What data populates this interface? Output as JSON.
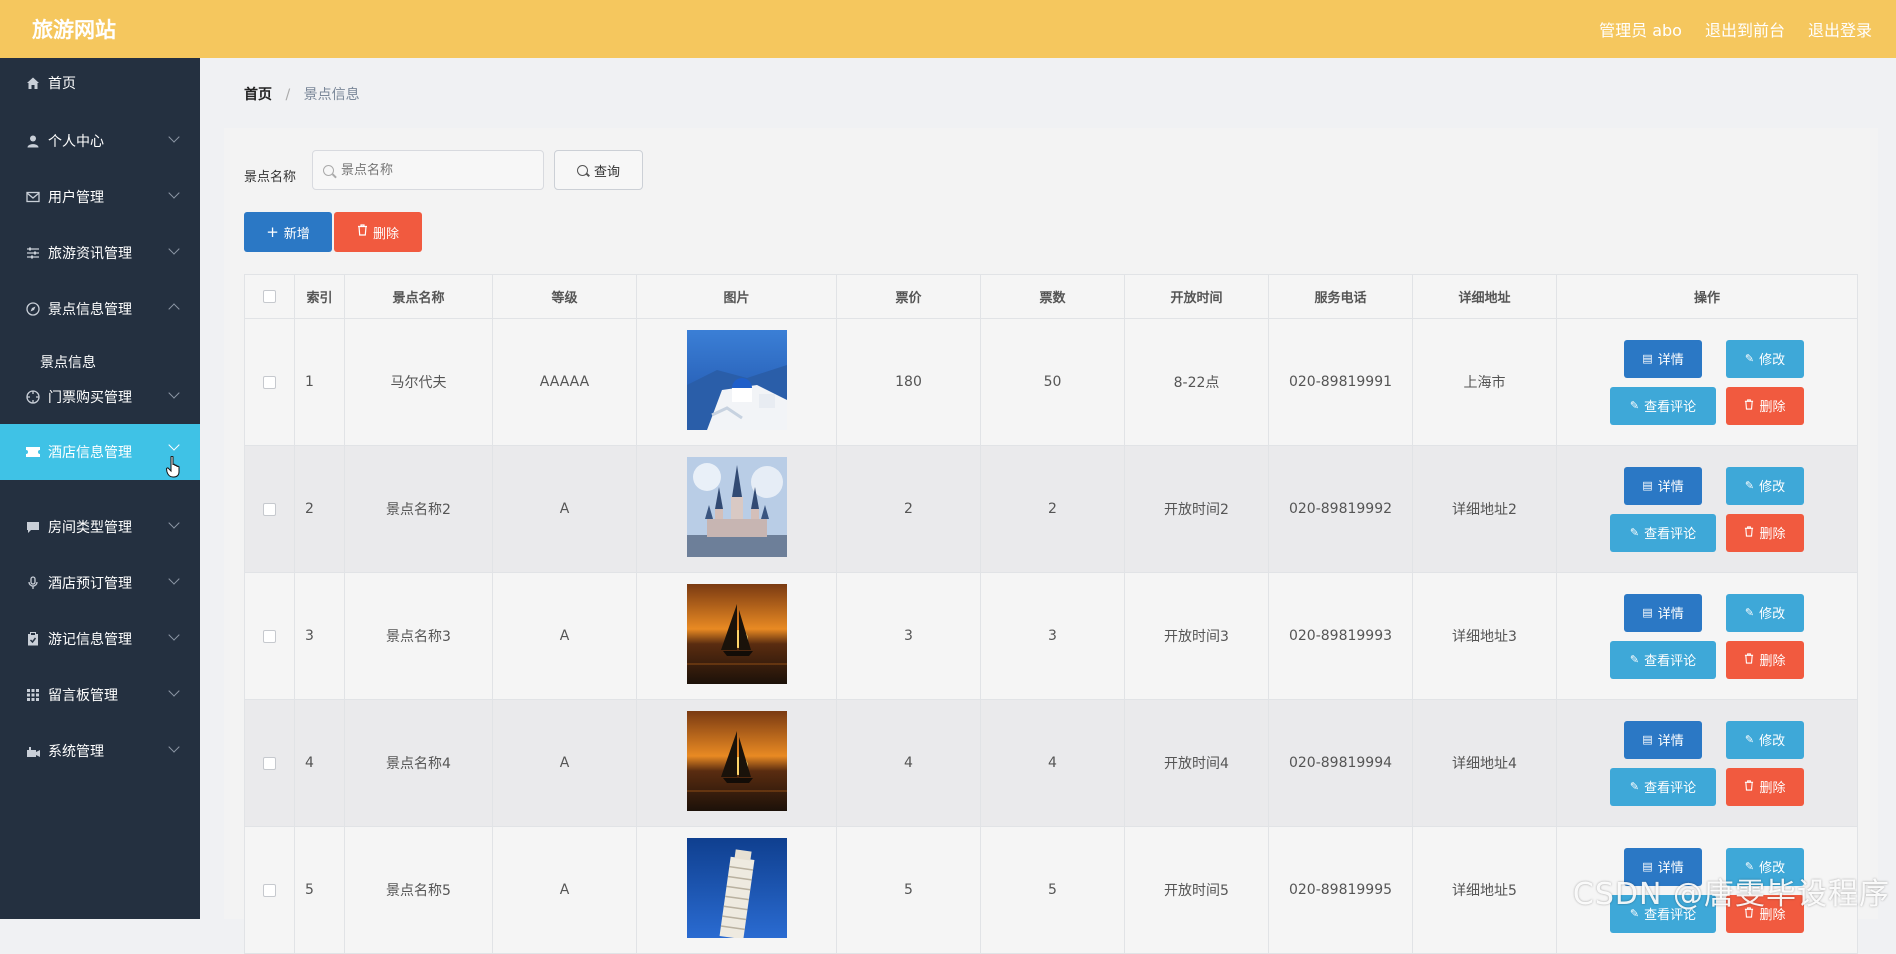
{
  "header": {
    "brand": "旅游网站",
    "admin": "管理员 abo",
    "back_front": "退出到前台",
    "logout": "退出登录"
  },
  "sidebar": {
    "items": [
      {
        "label": "首页",
        "icon": "home-icon"
      },
      {
        "label": "个人中心",
        "icon": "user-icon"
      },
      {
        "label": "用户管理",
        "icon": "mail-icon"
      },
      {
        "label": "旅游资讯管理",
        "icon": "sliders-icon"
      },
      {
        "label": "景点信息管理",
        "icon": "compass-icon"
      },
      {
        "label": "门票购买管理",
        "icon": "target-icon"
      },
      {
        "label": "酒店信息管理",
        "icon": "ticket-icon"
      },
      {
        "label": "房间类型管理",
        "icon": "chat-icon"
      },
      {
        "label": "酒店预订管理",
        "icon": "mic-icon"
      },
      {
        "label": "游记信息管理",
        "icon": "clipboard-icon"
      },
      {
        "label": "留言板管理",
        "icon": "grid-icon"
      },
      {
        "label": "系统管理",
        "icon": "settings-icon"
      }
    ],
    "sub_scenic": "景点信息"
  },
  "breadcrumb": {
    "home": "首页",
    "current": "景点信息"
  },
  "search": {
    "label": "景点名称",
    "placeholder": "景点名称",
    "button": "查询"
  },
  "toolbar": {
    "add": "新增",
    "delete": "删除"
  },
  "table": {
    "headers": [
      "索引",
      "景点名称",
      "等级",
      "图片",
      "票价",
      "票数",
      "开放时间",
      "服务电话",
      "详细地址",
      "操作"
    ],
    "rows": [
      {
        "index": "1",
        "name": "马尔代夫",
        "level": "AAAAA",
        "image": "santorini",
        "price": "180",
        "tickets": "50",
        "open": "8-22点",
        "phone": "020-89819991",
        "address": "上海市"
      },
      {
        "index": "2",
        "name": "景点名称2",
        "level": "A",
        "image": "castle",
        "price": "2",
        "tickets": "2",
        "open": "开放时间2",
        "phone": "020-89819992",
        "address": "详细地址2"
      },
      {
        "index": "3",
        "name": "景点名称3",
        "level": "A",
        "image": "sailboat",
        "price": "3",
        "tickets": "3",
        "open": "开放时间3",
        "phone": "020-89819993",
        "address": "详细地址3"
      },
      {
        "index": "4",
        "name": "景点名称4",
        "level": "A",
        "image": "sailboat",
        "price": "4",
        "tickets": "4",
        "open": "开放时间4",
        "phone": "020-89819994",
        "address": "详细地址4"
      },
      {
        "index": "5",
        "name": "景点名称5",
        "level": "A",
        "image": "pisa",
        "price": "5",
        "tickets": "5",
        "open": "开放时间5",
        "phone": "020-89819995",
        "address": "详细地址5"
      }
    ],
    "ops": {
      "detail": "详情",
      "edit": "修改",
      "comments": "查看评论",
      "delete": "删除"
    }
  },
  "watermark": "CSDN @唐雯毕设程序",
  "colors": {
    "topbar": "#f5c75e",
    "sidebar": "#243040",
    "active": "#3fc2e6",
    "primary": "#2b78c5",
    "info": "#3ea8d8",
    "danger": "#f15a3f"
  }
}
